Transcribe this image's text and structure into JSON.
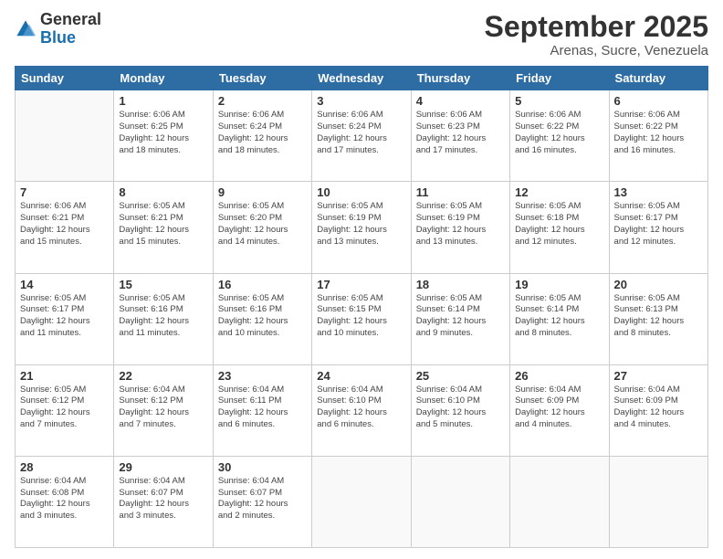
{
  "header": {
    "logo_general": "General",
    "logo_blue": "Blue",
    "month_title": "September 2025",
    "subtitle": "Arenas, Sucre, Venezuela"
  },
  "days_of_week": [
    "Sunday",
    "Monday",
    "Tuesday",
    "Wednesday",
    "Thursday",
    "Friday",
    "Saturday"
  ],
  "weeks": [
    [
      {
        "day": "",
        "info": ""
      },
      {
        "day": "1",
        "info": "Sunrise: 6:06 AM\nSunset: 6:25 PM\nDaylight: 12 hours\nand 18 minutes."
      },
      {
        "day": "2",
        "info": "Sunrise: 6:06 AM\nSunset: 6:24 PM\nDaylight: 12 hours\nand 18 minutes."
      },
      {
        "day": "3",
        "info": "Sunrise: 6:06 AM\nSunset: 6:24 PM\nDaylight: 12 hours\nand 17 minutes."
      },
      {
        "day": "4",
        "info": "Sunrise: 6:06 AM\nSunset: 6:23 PM\nDaylight: 12 hours\nand 17 minutes."
      },
      {
        "day": "5",
        "info": "Sunrise: 6:06 AM\nSunset: 6:22 PM\nDaylight: 12 hours\nand 16 minutes."
      },
      {
        "day": "6",
        "info": "Sunrise: 6:06 AM\nSunset: 6:22 PM\nDaylight: 12 hours\nand 16 minutes."
      }
    ],
    [
      {
        "day": "7",
        "info": "Sunrise: 6:06 AM\nSunset: 6:21 PM\nDaylight: 12 hours\nand 15 minutes."
      },
      {
        "day": "8",
        "info": "Sunrise: 6:05 AM\nSunset: 6:21 PM\nDaylight: 12 hours\nand 15 minutes."
      },
      {
        "day": "9",
        "info": "Sunrise: 6:05 AM\nSunset: 6:20 PM\nDaylight: 12 hours\nand 14 minutes."
      },
      {
        "day": "10",
        "info": "Sunrise: 6:05 AM\nSunset: 6:19 PM\nDaylight: 12 hours\nand 13 minutes."
      },
      {
        "day": "11",
        "info": "Sunrise: 6:05 AM\nSunset: 6:19 PM\nDaylight: 12 hours\nand 13 minutes."
      },
      {
        "day": "12",
        "info": "Sunrise: 6:05 AM\nSunset: 6:18 PM\nDaylight: 12 hours\nand 12 minutes."
      },
      {
        "day": "13",
        "info": "Sunrise: 6:05 AM\nSunset: 6:17 PM\nDaylight: 12 hours\nand 12 minutes."
      }
    ],
    [
      {
        "day": "14",
        "info": "Sunrise: 6:05 AM\nSunset: 6:17 PM\nDaylight: 12 hours\nand 11 minutes."
      },
      {
        "day": "15",
        "info": "Sunrise: 6:05 AM\nSunset: 6:16 PM\nDaylight: 12 hours\nand 11 minutes."
      },
      {
        "day": "16",
        "info": "Sunrise: 6:05 AM\nSunset: 6:16 PM\nDaylight: 12 hours\nand 10 minutes."
      },
      {
        "day": "17",
        "info": "Sunrise: 6:05 AM\nSunset: 6:15 PM\nDaylight: 12 hours\nand 10 minutes."
      },
      {
        "day": "18",
        "info": "Sunrise: 6:05 AM\nSunset: 6:14 PM\nDaylight: 12 hours\nand 9 minutes."
      },
      {
        "day": "19",
        "info": "Sunrise: 6:05 AM\nSunset: 6:14 PM\nDaylight: 12 hours\nand 8 minutes."
      },
      {
        "day": "20",
        "info": "Sunrise: 6:05 AM\nSunset: 6:13 PM\nDaylight: 12 hours\nand 8 minutes."
      }
    ],
    [
      {
        "day": "21",
        "info": "Sunrise: 6:05 AM\nSunset: 6:12 PM\nDaylight: 12 hours\nand 7 minutes."
      },
      {
        "day": "22",
        "info": "Sunrise: 6:04 AM\nSunset: 6:12 PM\nDaylight: 12 hours\nand 7 minutes."
      },
      {
        "day": "23",
        "info": "Sunrise: 6:04 AM\nSunset: 6:11 PM\nDaylight: 12 hours\nand 6 minutes."
      },
      {
        "day": "24",
        "info": "Sunrise: 6:04 AM\nSunset: 6:10 PM\nDaylight: 12 hours\nand 6 minutes."
      },
      {
        "day": "25",
        "info": "Sunrise: 6:04 AM\nSunset: 6:10 PM\nDaylight: 12 hours\nand 5 minutes."
      },
      {
        "day": "26",
        "info": "Sunrise: 6:04 AM\nSunset: 6:09 PM\nDaylight: 12 hours\nand 4 minutes."
      },
      {
        "day": "27",
        "info": "Sunrise: 6:04 AM\nSunset: 6:09 PM\nDaylight: 12 hours\nand 4 minutes."
      }
    ],
    [
      {
        "day": "28",
        "info": "Sunrise: 6:04 AM\nSunset: 6:08 PM\nDaylight: 12 hours\nand 3 minutes."
      },
      {
        "day": "29",
        "info": "Sunrise: 6:04 AM\nSunset: 6:07 PM\nDaylight: 12 hours\nand 3 minutes."
      },
      {
        "day": "30",
        "info": "Sunrise: 6:04 AM\nSunset: 6:07 PM\nDaylight: 12 hours\nand 2 minutes."
      },
      {
        "day": "",
        "info": ""
      },
      {
        "day": "",
        "info": ""
      },
      {
        "day": "",
        "info": ""
      },
      {
        "day": "",
        "info": ""
      }
    ]
  ]
}
